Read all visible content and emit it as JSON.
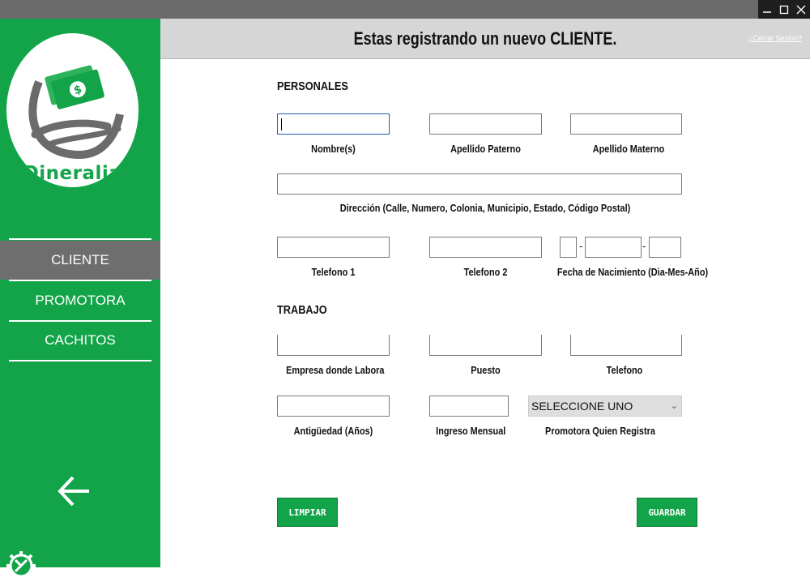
{
  "window": {
    "minimize_icon": "minimize-icon",
    "maximize_icon": "maximize-icon",
    "close_icon": "close-icon"
  },
  "sidebar": {
    "logo_text": "Dineralia",
    "items": [
      {
        "label": "CLIENTE",
        "active": true
      },
      {
        "label": "PROMOTORA",
        "active": false
      },
      {
        "label": "CACHITOS",
        "active": false
      }
    ],
    "back_icon": "arrow-left-icon",
    "settings_icon": "gear-icon"
  },
  "header": {
    "title": "Estas registrando un nuevo CLIENTE.",
    "logout_link": "¿Cerrar Sesion?"
  },
  "form": {
    "personales_title": "PERSONALES",
    "trabajo_title": "TRABAJO",
    "labels": {
      "nombre": "Nombre(s)",
      "apellido_paterno": "Apellido Paterno",
      "apellido_materno": "Apellido Materno",
      "direccion": "Dirección (Calle, Numero, Colonia, Municipio, Estado, Código Postal)",
      "telefono1": "Telefono 1",
      "telefono2": "Telefono 2",
      "fecha_nacimiento": "Fecha de Nacimiento (Dia-Mes-Año)",
      "empresa": "Empresa donde Labora",
      "puesto": "Puesto",
      "telefono_trabajo": "Telefono",
      "antiguedad": "Antigüedad (Años)",
      "ingreso": "Ingreso Mensual",
      "promotora": "Promotora Quien Registra"
    },
    "date_separator": "-",
    "promotora_select": "SELECCIONE UNO"
  },
  "buttons": {
    "limpiar": "LIMPIAR",
    "guardar": "GUARDAR"
  },
  "colors": {
    "brand_green": "#13a44a",
    "active_nav": "#6e6e6e",
    "header_bg": "#d6d6d6"
  }
}
